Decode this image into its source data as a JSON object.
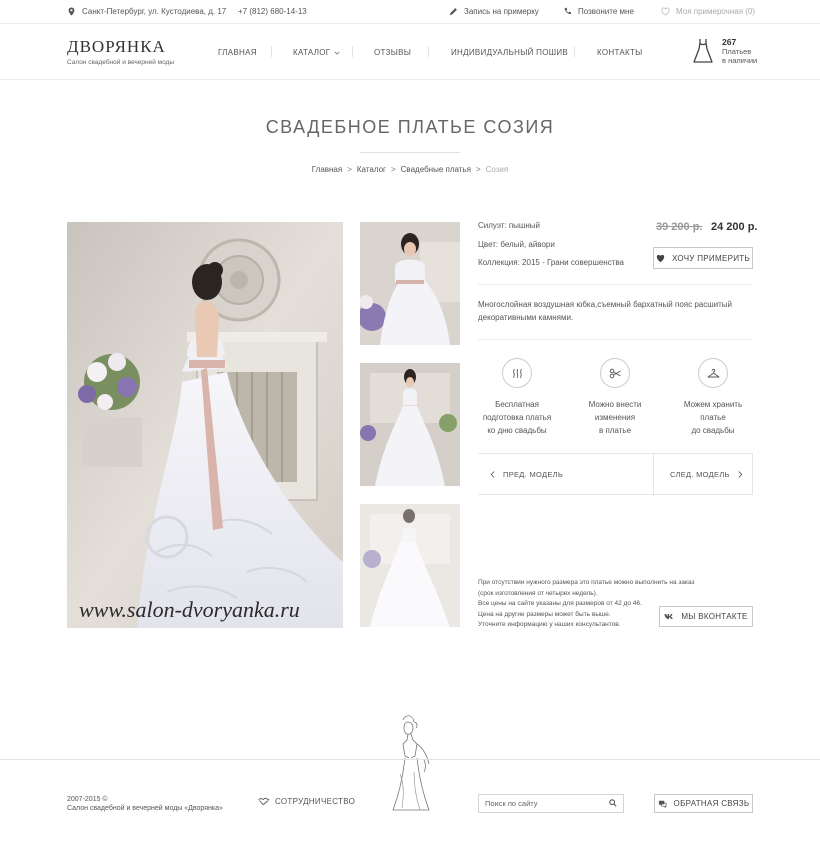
{
  "topbar": {
    "address": "Санкт-Петербург, ул. Кустодиева, д. 17",
    "phone": "+7 (812) 680-14-13",
    "fitting": "Запись на примерку",
    "callback": "Позвоните мне",
    "wishlist": "Моя примерочная (0)"
  },
  "logo": {
    "name": "ДВОРЯНКА",
    "tagline": "Салон свадебной и вечерней моды"
  },
  "nav": {
    "home": "ГЛАВНАЯ",
    "catalog": "КАТАЛОГ",
    "reviews": "ОТЗЫВЫ",
    "tailoring": "ИНДИВИДУАЛЬНЫЙ ПОШИВ",
    "contacts": "КОНТАКТЫ"
  },
  "stock": {
    "count": "267",
    "line1": "Платьев",
    "line2": "в наличии"
  },
  "page": {
    "title": "СВАДЕБНОЕ ПЛАТЬЕ СОЗИЯ"
  },
  "breadcrumb": {
    "home": "Главная",
    "catalog": "Каталог",
    "category": "Свадебные платья",
    "current": "Созия",
    "separator": ">"
  },
  "photo": {
    "watermark": "www.salon-dvoryanka.ru"
  },
  "product": {
    "silhouette": "Силуэт: пышный",
    "color": "Цвет: белый, айвори",
    "collection": "Коллекция: 2015 - Грани совершенства",
    "old_price": "39 200 р.",
    "price": "24 200 р.",
    "try_button": "ХОЧУ ПРИМЕРИТЬ",
    "description": "Многослойная воздушная юбка,съемный бархатный пояс расшитый декоративными камнями."
  },
  "features": [
    {
      "icon": "steam-icon",
      "text": "Бесплатная\nподготовка платья\nко дню свадьбы"
    },
    {
      "icon": "scissors-icon",
      "text": "Можно внести\nизменения\nв платье"
    },
    {
      "icon": "hanger-icon",
      "text": "Можем хранить\nплатье\nдо свадьбы"
    }
  ],
  "pager": {
    "prev": "ПРЕД. МОДЕЛЬ",
    "next": "СЛЕД. МОДЕЛЬ"
  },
  "note": {
    "line1": "При отсутствии нужного размера это платье можно выполнить на заказ",
    "line2": "(срок изготовления от четырех недель).",
    "line3": "Все цены на сайте указаны для размеров от 42 до 46.",
    "line4": "Цена на другие размеры может быть выше.",
    "line5": "Уточните информацию у наших консультантов."
  },
  "vk_button": "МЫ ВКОНТАКТЕ",
  "footer": {
    "years": "2007-2015 ©",
    "company": "Салон свадебной и вечерней моды «Дворянка»",
    "cooperation": "СОТРУДНИЧЕСТВО",
    "search_placeholder": "Поиск по сайту",
    "feedback": "ОБРАТНАЯ СВЯЗЬ"
  },
  "colors": {
    "text": "#4a4a4a",
    "muted": "#999999",
    "border": "#c8c8c8"
  }
}
